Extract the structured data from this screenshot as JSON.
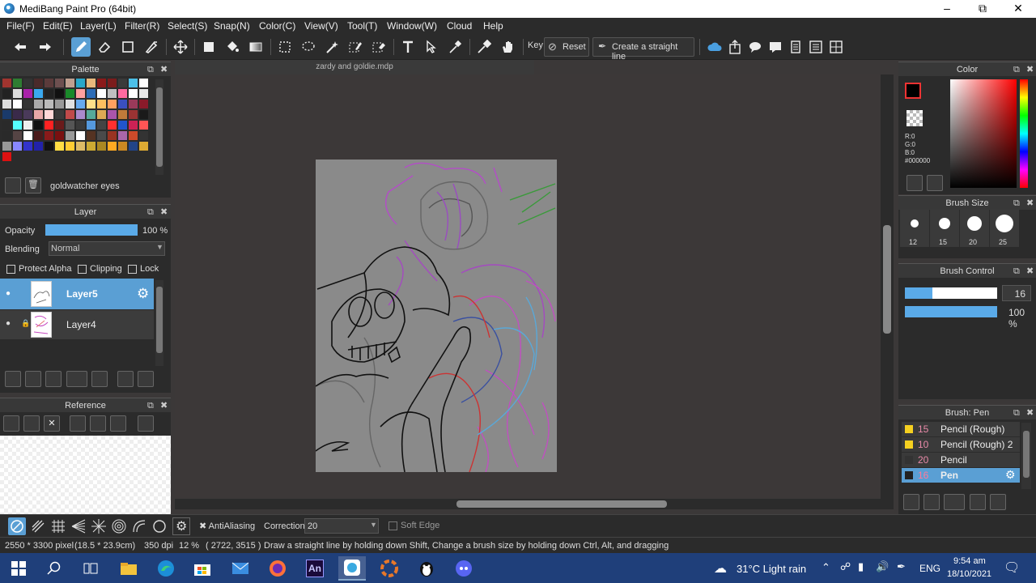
{
  "app": {
    "title": "MediBang Paint Pro (64bit)"
  },
  "menu": [
    "File(F)",
    "Edit(E)",
    "Layer(L)",
    "Filter(R)",
    "Select(S)",
    "Snap(N)",
    "Color(C)",
    "View(V)",
    "Tool(T)",
    "Window(W)",
    "Cloud",
    "Help"
  ],
  "toolbar": {
    "key_label": "Key",
    "reset_label": "Reset",
    "straight_line_label": "Create a straight line"
  },
  "palette": {
    "title": "Palette",
    "current_name": "goldwatcher eyes",
    "swatches": [
      "#a0342f",
      "#2e7d32",
      "#333333",
      "#4a2a2a",
      "#5b3b3b",
      "#6d5050",
      "#c0a090",
      "#2aa7c9",
      "#e8b97c",
      "#8a1a1a",
      "#7b1c1c",
      "#3a3a3a",
      "#4cc0e8",
      "#ffffff",
      "#222222",
      "#dddddd",
      "#aa22aa",
      "#3aa9f0",
      "#222222",
      "#111111",
      "#1a8a2a",
      "#ffa0a0",
      "#2d6db7",
      "#ffffff",
      "#c0c0c0",
      "#ff6aa0",
      "#ffffff",
      "#e9e9e9",
      "#dddddd",
      "#ffffff",
      "#333333",
      "#aaaaaa",
      "#bbbbbb",
      "#999999",
      "#e0e0e0",
      "#66aaee",
      "#ffe08a",
      "#ffc060",
      "#ffa060",
      "#3a50c0",
      "#9a3a5a",
      "#8a1a2a",
      "#1a3a6a",
      "#3a2a4a",
      "#4a3a5a",
      "#e8a8a8",
      "#ffd8d8",
      "#3a3a3a",
      "#c04a4a",
      "#aa8acc",
      "#55aa99",
      "#ddaa55",
      "#aa55aa",
      "#c07a3a",
      "#993333",
      "#1a1a1a",
      "#2a2a2a",
      "#55ffff",
      "#eeeeee",
      "#111111",
      "#ff2222",
      "#6a1a1a",
      "#555555",
      "#3a3a3a",
      "#5599dd",
      "#444444",
      "#ff3030",
      "#2255cc",
      "#cc2255",
      "#ff5555",
      "#2a2a2a",
      "#554444",
      "#ffffff",
      "#4a1a1a",
      "#8a1a1a",
      "#7a1010",
      "#999999",
      "#ffffff",
      "#553322",
      "#4a4a4a",
      "#993322",
      "#aa66aa",
      "#cc4a2a",
      "#333333",
      "#999999",
      "#8888ff",
      "#3333cc",
      "#2222aa",
      "#111111",
      "#ffdd44",
      "#ffcc33",
      "#ddbb66",
      "#ccaa33",
      "#aa8822",
      "#ffaa22",
      "#cc8822",
      "#224488",
      "#ddaa33",
      "#dd1111"
    ]
  },
  "layer_panel": {
    "title": "Layer",
    "opacity_label": "Opacity",
    "opacity_value": "100 %",
    "opacity_fraction": 1.0,
    "blending_label": "Blending",
    "blending_value": "Normal",
    "protect_alpha": "Protect Alpha",
    "clipping": "Clipping",
    "lock": "Lock",
    "layers": [
      {
        "name": "Layer5",
        "selected": true
      },
      {
        "name": "Layer4",
        "selected": false
      }
    ]
  },
  "reference": {
    "title": "Reference"
  },
  "document": {
    "tab": "zardy and goldie.mdp"
  },
  "color_panel": {
    "title": "Color",
    "r": "R:0",
    "g": "G:0",
    "b": "B:0",
    "hex": "#000000",
    "primary_color": "#000000"
  },
  "brush_size": {
    "title": "Brush Size",
    "sizes": [
      "12",
      "15",
      "20",
      "25"
    ]
  },
  "brush_control": {
    "title": "Brush Control",
    "size_value": "16",
    "size_fraction": 0.3,
    "opacity_value": "100 %",
    "opacity_fraction": 1.0
  },
  "brush_list": {
    "title": "Brush: Pen",
    "items": [
      {
        "num": "15",
        "name": "Pencil (Rough)",
        "color": "#f5d020",
        "selected": false
      },
      {
        "num": "10",
        "name": "Pencil (Rough) 2",
        "color": "#f5d020",
        "selected": false
      },
      {
        "num": "20",
        "name": "Pencil",
        "color": "#333333",
        "selected": false
      },
      {
        "num": "16",
        "name": "Pen",
        "color": "#222222",
        "selected": true
      }
    ]
  },
  "bottom_toolbar": {
    "antialiasing": "AntiAliasing",
    "correction_label": "Correction",
    "correction_value": "20",
    "soft_edge": "Soft Edge"
  },
  "status": {
    "size": "2550 * 3300 pixel",
    "cm": "(18.5 * 23.9cm)",
    "dpi": "350 dpi",
    "zoom": "12 %",
    "coords": "( 2722, 3515 )",
    "hint": "Draw a straight line by holding down Shift, Change a brush size by holding down Ctrl, Alt, and dragging"
  },
  "taskbar": {
    "weather": "31°C  Light rain",
    "lang": "ENG",
    "time": "9:54 am",
    "date": "18/10/2021"
  }
}
